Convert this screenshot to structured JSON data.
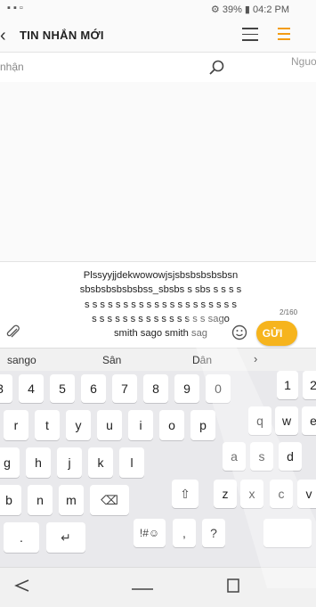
{
  "status_bar": {
    "left_icons": "▪ ▪ ▫",
    "right_text": "⚙ 39% ▮ 04:2 PM"
  },
  "header": {
    "title": "TIN NHẮN MỚI"
  },
  "recipient": {
    "placeholder": "nhận",
    "hint": "Nguo"
  },
  "compose": {
    "text": "Plssyyjjdekwowowjsjsbsbsbsbsbsn\nsbsbsbsbsbsbss_sbsbs s sbs s s s s\ns s s s s s s s s s s s s s s s s s s s\ns s s s s s s s s s s s s s s sago\nsmith sago smith sag",
    "counter": "2/160",
    "send_label": "GỬI"
  },
  "suggestions": [
    "sango",
    "Sân",
    "Dân"
  ],
  "keyboard": {
    "row_numbers": [
      "3",
      "4",
      "5",
      "6",
      "7",
      "8",
      "9",
      "0"
    ],
    "row_top": [
      "r",
      "t",
      "y",
      "u",
      "i",
      "o",
      "p"
    ],
    "row_mid": [
      "g",
      "h",
      "j",
      "k",
      "l"
    ],
    "row_bottom": [
      "b",
      "n",
      "m"
    ],
    "row_space": [
      ".",
      "↵"
    ],
    "float_numbers": [
      "1",
      "2"
    ],
    "float_top": [
      "q",
      "w",
      "e"
    ],
    "float_mid": [
      "a",
      "s",
      "d"
    ],
    "float_bottom": [
      "z",
      "x",
      "c",
      "v"
    ],
    "float_space": [
      "!#☺",
      ",",
      "?",
      ","
    ],
    "backspace": "⌫",
    "shift": "⇧"
  },
  "icon_names": [
    "back-icon",
    "menu-icon",
    "search-icon",
    "attach-icon",
    "emoji-icon",
    "send-button",
    "nav-back-icon",
    "nav-home-icon",
    "nav-recent-icon"
  ]
}
